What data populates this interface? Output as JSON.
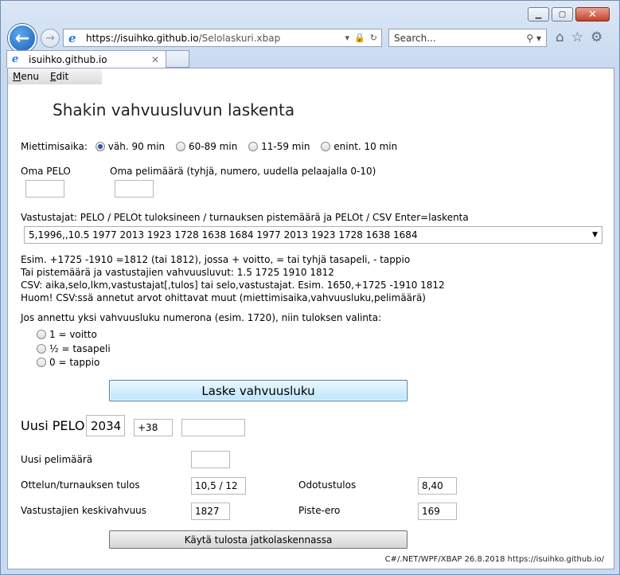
{
  "browser": {
    "address_host": "https://isuihko.github.io",
    "address_path": "/Selolaskuri.xbap",
    "search_placeholder": "Search...",
    "tab_label": "isuihko.github.io"
  },
  "menu": {
    "items": [
      "Menu",
      "Edit"
    ]
  },
  "page": {
    "title": "Shakin vahvuusluvun laskenta",
    "time_label": "Miettimisaika:",
    "time_options": [
      "väh. 90 min",
      "60-89 min",
      "11-59 min",
      "enint. 10 min"
    ],
    "own_pelo_label": "Oma PELO",
    "own_pelo_value": "",
    "own_games_label": "Oma pelimäärä (tyhjä, numero, uudella pelaajalla 0-10)",
    "own_games_value": "",
    "opponents_label": "Vastustajat: PELO / PELOt tuloksineen / turnauksen pistemäärä ja PELOt / CSV  Enter=laskenta",
    "opponents_value": "5,1996,,10.5 1977 2013 1923 1728 1638 1684 1977 2013 1923 1728 1638 1684",
    "help_lines": [
      "Esim. +1725 -1910 =1812 (tai 1812), jossa + voitto, = tai tyhjä tasapeli, - tappio",
      "Tai pistemäärä ja vastustajien vahvuusluvut: 1.5 1725 1910 1812",
      "CSV: aika,selo,lkm,vastustajat[,tulos] tai selo,vastustajat. Esim. 1650,+1725 -1910 1812",
      "Huom! CSV:ssä annetut arvot ohittavat muut (miettimisaika,vahvuusluku,pelimäärä)"
    ],
    "single_result_label": "Jos annettu yksi vahvuusluku numerona (esim. 1720), niin tuloksen valinta:",
    "result_options": [
      "1 = voitto",
      "½ = tasapeli",
      "0 = tappio"
    ],
    "calc_button": "Laske vahvuusluku",
    "new_pelo_label": "Uusi PELO",
    "new_pelo_value": "2034",
    "pelo_change": "+38",
    "pelo_extra": "",
    "new_games_label": "Uusi pelimäärä",
    "new_games_value": "",
    "result_label": "Ottelun/turnauksen tulos",
    "result_value": "10,5 / 12",
    "expected_label": "Odotustulos",
    "expected_value": "8,40",
    "avg_label": "Vastustajien keskivahvuus",
    "avg_value": "1827",
    "diff_label": "Piste-ero",
    "diff_value": "169",
    "continue_button": "Käytä tulosta jatkolaskennassa",
    "footer": "C#/.NET/WPF/XBAP 26.8.2018 https://isuihko.github.io/"
  },
  "colors": {
    "accent": "#2a5aa8",
    "button_blue": "#bee6fd"
  }
}
